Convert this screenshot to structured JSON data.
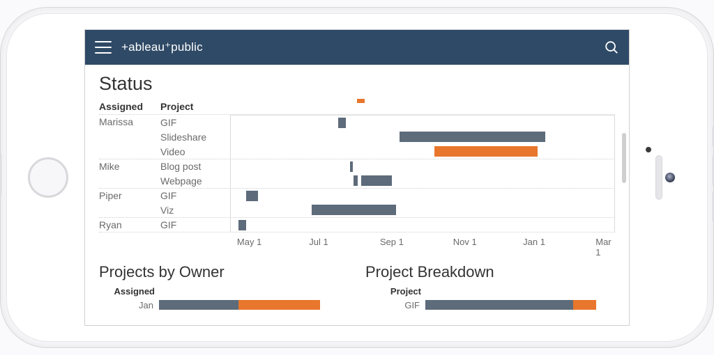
{
  "brand": {
    "text": "+ableau⁺public"
  },
  "section_status": "Status",
  "headers": {
    "assigned": "Assigned",
    "project": "Project"
  },
  "axis_ticks": [
    "May 1",
    "Jul 1",
    "Sep 1",
    "Nov 1",
    "Jan 1",
    "Mar 1"
  ],
  "colors": {
    "blue": "#5d6b7a",
    "orange": "#e8762c",
    "topbar": "#2f4a66"
  },
  "section_by_owner": "Projects by Owner",
  "section_breakdown": "Project Breakdown",
  "by_owner_header": "Assigned",
  "breakdown_header": "Project",
  "chart_data": [
    {
      "type": "bar",
      "title": "Status",
      "orientation": "horizontal-gantt",
      "x_axis": {
        "type": "date",
        "ticks": [
          "May 1",
          "Jul 1",
          "Sep 1",
          "Nov 1",
          "Jan 1",
          "Mar 1"
        ],
        "range_pct": [
          0,
          100
        ]
      },
      "column_headers": [
        "Assigned",
        "Project"
      ],
      "rows": [
        {
          "owner": "Marissa",
          "project": "GIF",
          "start_pct": 28,
          "end_pct": 30,
          "color": "blue"
        },
        {
          "owner": "Marissa",
          "project": "Slideshare",
          "start_pct": 44,
          "end_pct": 82,
          "color": "blue"
        },
        {
          "owner": "Marissa",
          "project": "Video",
          "start_pct": 53,
          "end_pct": 80,
          "color": "orange"
        },
        {
          "owner": "Mike",
          "project": "Blog post",
          "start_pct": 31,
          "end_pct": 32,
          "color": "blue"
        },
        {
          "owner": "Mike",
          "project": "Webpage",
          "start_pct": 33,
          "end_pct": 42,
          "color": "blue"
        },
        {
          "owner": "Piper",
          "project": "GIF",
          "start_pct": 4,
          "end_pct": 7,
          "color": "blue"
        },
        {
          "owner": "Piper",
          "project": "Viz",
          "start_pct": 21,
          "end_pct": 43,
          "color": "blue"
        },
        {
          "owner": "Ryan",
          "project": "GIF",
          "start_pct": 2,
          "end_pct": 4,
          "color": "blue"
        }
      ],
      "overflow_marker": {
        "start_pct": 33,
        "end_pct": 35,
        "color": "orange"
      }
    },
    {
      "type": "bar",
      "title": "Projects by Owner",
      "orientation": "horizontal-stacked",
      "header": "Assigned",
      "rows": [
        {
          "label": "Jan",
          "segments": [
            {
              "start_pct": 0,
              "end_pct": 42,
              "color": "blue"
            },
            {
              "start_pct": 42,
              "end_pct": 85,
              "color": "orange"
            }
          ]
        }
      ]
    },
    {
      "type": "bar",
      "title": "Project Breakdown",
      "orientation": "horizontal-stacked",
      "header": "Project",
      "rows": [
        {
          "label": "GIF",
          "segments": [
            {
              "start_pct": 0,
              "end_pct": 78,
              "color": "blue"
            },
            {
              "start_pct": 78,
              "end_pct": 90,
              "color": "orange"
            }
          ]
        }
      ]
    }
  ]
}
